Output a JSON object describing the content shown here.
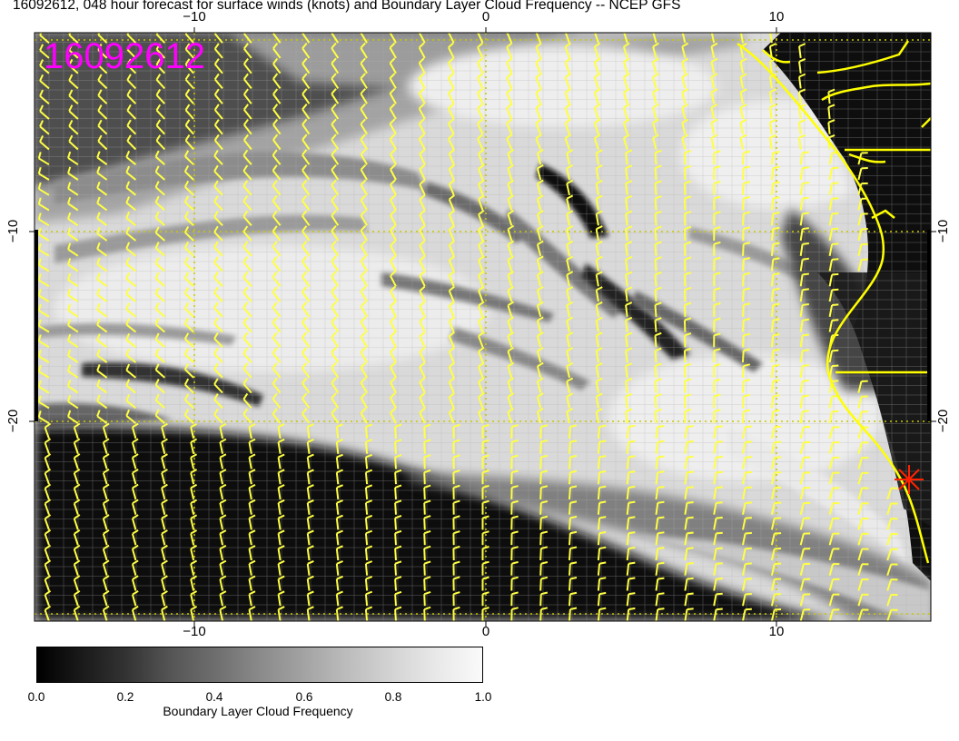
{
  "title": "16092612, 048 hour forecast for surface winds (knots) and Boundary Layer Cloud Frequency -- NCEP GFS",
  "datestamp": "16092612",
  "axes": {
    "top_ticks": [
      "−10",
      "0",
      "10"
    ],
    "bottom_ticks": [
      "−10",
      "0",
      "10"
    ],
    "left_ticks": [
      "−10",
      "−20"
    ],
    "right_ticks": [
      "−10",
      "−20"
    ],
    "lon_range": [
      -15.5,
      15.5
    ],
    "lat_range": [
      -29.5,
      -0.5
    ]
  },
  "colorbar": {
    "ticks": [
      "0.0",
      "0.2",
      "0.4",
      "0.6",
      "0.8",
      "1.0"
    ],
    "label": "Boundary Layer Cloud Frequency",
    "range": [
      0.0,
      1.0
    ],
    "colors": [
      "#000000",
      "#ffffff"
    ]
  },
  "colors": {
    "wind_barbs": "#ffff44",
    "coastline": "#ffff00",
    "grid": "#c8c800",
    "datestamp": "#ff00ff",
    "marker": "#ff2200"
  },
  "marker": {
    "icon": "asterisk-star",
    "lon": 14.5,
    "lat": -22.9
  },
  "wind_field": {
    "description_units": "knots",
    "bands": [
      {
        "lat_from": -1,
        "lat_to": -7,
        "west_dir": 130,
        "east_dir": 180
      },
      {
        "lat_from": -7,
        "lat_to": -20,
        "west_dir": 120,
        "east_dir": 200
      },
      {
        "lat_from": -20,
        "lat_to": -30,
        "west_dir": 160,
        "east_dir": 200
      }
    ]
  }
}
